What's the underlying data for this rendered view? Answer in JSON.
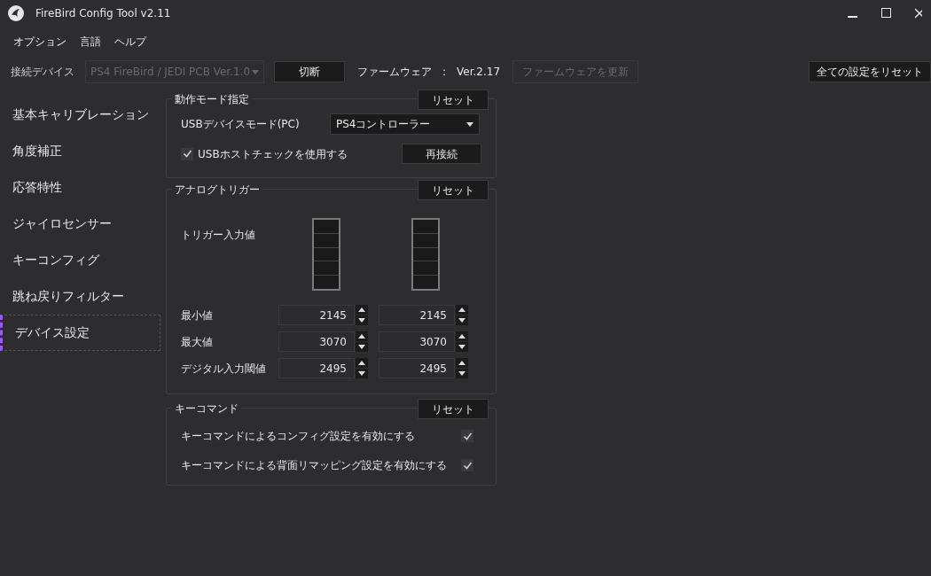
{
  "window": {
    "title": "FireBird Config Tool v2.11"
  },
  "menu": [
    "オプション",
    "言語",
    "ヘルプ"
  ],
  "toolbar": {
    "device_label": "接続デバイス",
    "device_value": "PS4 FireBird / JEDI PCB Ver.1.0",
    "device_disabled": true,
    "disconnect": "切断",
    "firmware_label": "ファームウェア",
    "firmware_sep": ":",
    "firmware_version": "Ver.2.17",
    "update_button": "ファームウェアを更新",
    "update_disabled": true,
    "reset_all": "全ての設定をリセット"
  },
  "sidebar": {
    "items": [
      {
        "label": "基本キャリブレーション",
        "selected": false
      },
      {
        "label": "角度補正",
        "selected": false
      },
      {
        "label": "応答特性",
        "selected": false
      },
      {
        "label": "ジャイロセンサー",
        "selected": false
      },
      {
        "label": "キーコンフィグ",
        "selected": false
      },
      {
        "label": "跳ね戻りフィルター",
        "selected": false
      },
      {
        "label": "デバイス設定",
        "selected": true
      }
    ]
  },
  "mode_group": {
    "title": "動作モード指定",
    "reset": "リセット",
    "usb_mode_label": "USBデバイスモード(PC)",
    "usb_mode_value": "PS4コントローラー",
    "host_check": {
      "label": "USBホストチェックを使用する",
      "checked": true
    },
    "reconnect": "再接続"
  },
  "trigger_group": {
    "title": "アナログトリガー",
    "reset": "リセット",
    "input_label": "トリガー入力値",
    "rows": [
      {
        "label": "最小値",
        "values": [
          "2145",
          "2145"
        ]
      },
      {
        "label": "最大値",
        "values": [
          "3070",
          "3070"
        ]
      },
      {
        "label": "デジタル入力閾値",
        "values": [
          "2495",
          "2495"
        ]
      }
    ]
  },
  "key_command_group": {
    "title": "キーコマンド",
    "reset": "リセット",
    "options": [
      {
        "label": "キーコマンドによるコンフィグ設定を有効にする",
        "checked": true
      },
      {
        "label": "キーコマンドによる背面リマッピング設定を有効にする",
        "checked": true
      }
    ]
  }
}
